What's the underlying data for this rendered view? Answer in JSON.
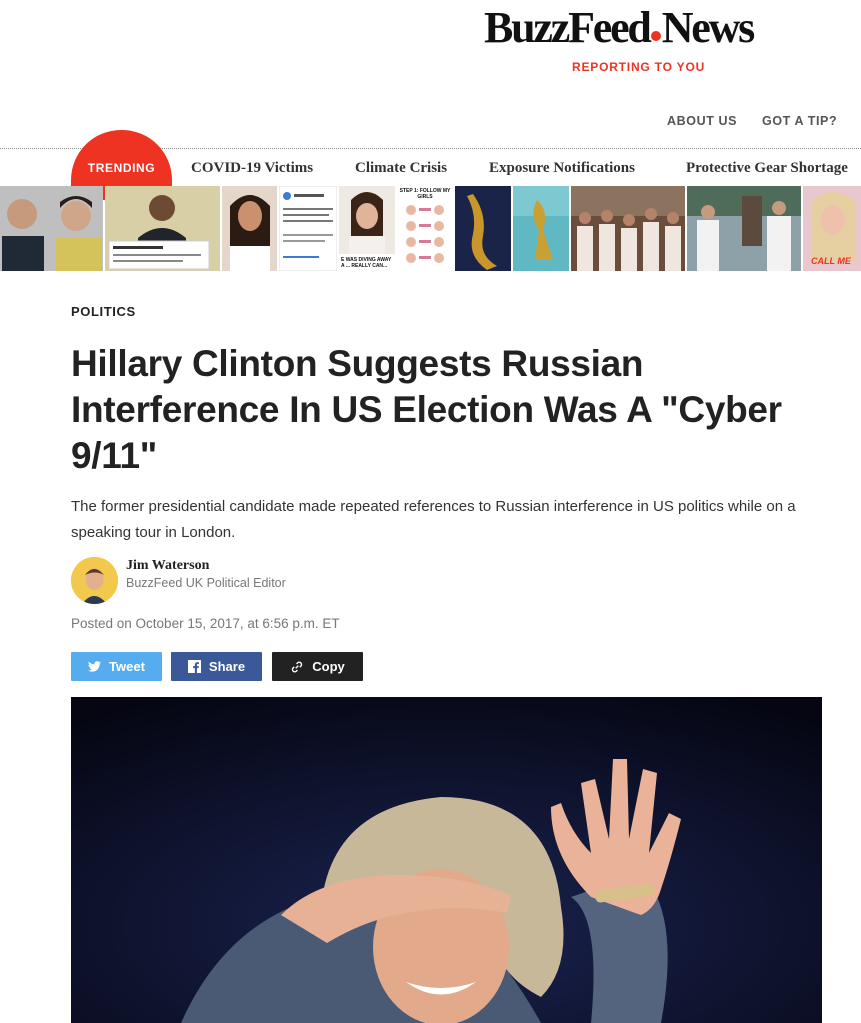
{
  "brand": {
    "logo_word1": "BuzzFeed",
    "logo_word2": "News",
    "tagline": "REPORTING TO YOU",
    "accent": "#ee3322"
  },
  "topnav": {
    "about": "ABOUT US",
    "tip": "GOT A TIP?"
  },
  "trending": {
    "label": "TRENDING",
    "links": [
      "COVID-19 Victims",
      "Climate Crisis",
      "Exposure Notifications",
      "Protective Gear Shortage"
    ],
    "thumb_texts": {
      "step": "STEP 1: FOLLOW MY GIRLS",
      "diving": "E WAS DIVING AWAY A ... REALLY CAN...",
      "call": "CALL ME"
    }
  },
  "article": {
    "section": "POLITICS",
    "headline": "Hillary Clinton Suggests Russian Interference In US Election Was A \"Cyber 9/11\"",
    "dek": "The former presidential candidate made repeated references to Russian interference in US politics while on a speaking tour in London.",
    "author_name": "Jim Waterson",
    "author_title": "BuzzFeed UK Political Editor",
    "posted": "Posted on October 15, 2017, at 6:56 p.m. ET"
  },
  "share": {
    "tweet": "Tweet",
    "share": "Share",
    "copy": "Copy",
    "icons": [
      "twitter-bird-icon",
      "facebook-f-icon",
      "link-icon"
    ]
  }
}
